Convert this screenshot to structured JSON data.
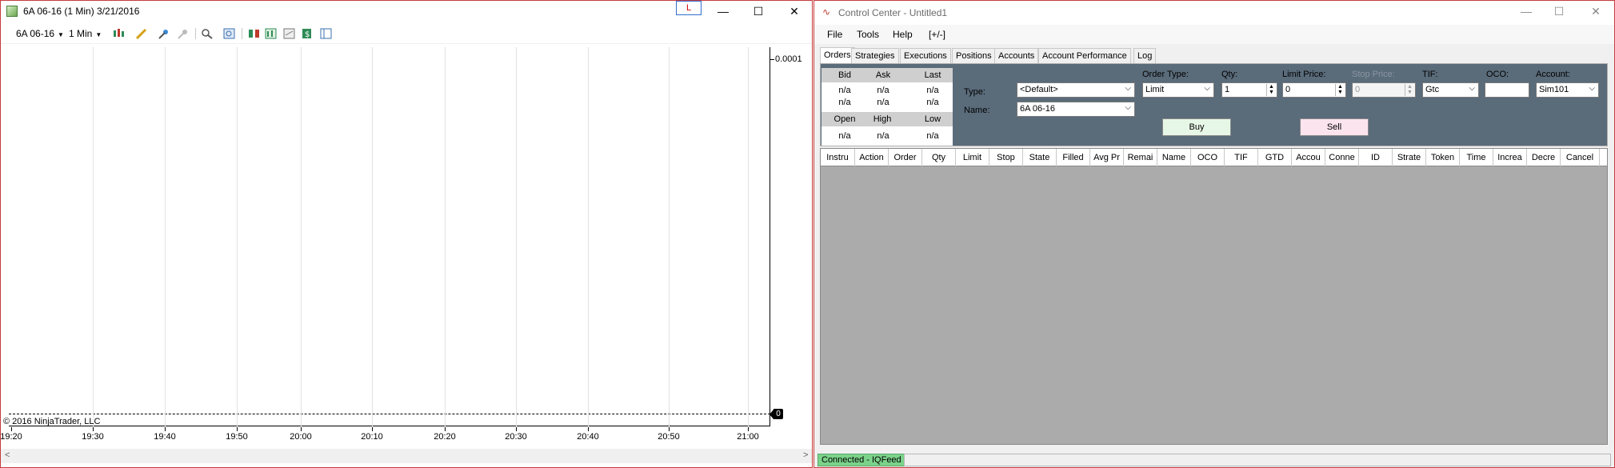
{
  "chart_window": {
    "title": "6A 06-16 (1 Min)  3/21/2016",
    "link_button": "L",
    "controls": {
      "minimize": "—",
      "maximize": "☐",
      "close": "✕"
    },
    "toolbar": {
      "instrument": "6A 06-16",
      "interval": "1 Min"
    },
    "icons": [
      "chart-style-icon",
      "drawing-tool-icon",
      "pin-icon",
      "pin-disabled-icon",
      "zoom-icon",
      "search-icon",
      "strategies-icon",
      "indicators-icon",
      "data-box-icon",
      "dollar-icon",
      "properties-icon"
    ],
    "y_label_top": "0.0001",
    "zero_marker": "0",
    "copyright": "© 2016 NinjaTrader, LLC",
    "scroll_left": "<",
    "scroll_right": ">"
  },
  "chart_data": {
    "type": "line",
    "x_ticks": [
      "19:20",
      "19:30",
      "19:40",
      "19:50",
      "20:00",
      "20:10",
      "20:20",
      "20:30",
      "20:40",
      "20:50",
      "21:00"
    ],
    "y_ticks": [
      "0.0001"
    ],
    "zero_value_label": "0",
    "series": [],
    "grid": "vertical"
  },
  "control_center": {
    "title": "Control Center - Untitled1",
    "controls": {
      "minimize": "—",
      "maximize": "☐",
      "close": "✕"
    },
    "menu": [
      "File",
      "Tools",
      "Help",
      "[+/-]"
    ],
    "tabs": [
      "Orders",
      "Strategies",
      "Executions",
      "Positions",
      "Accounts",
      "Account Performance",
      "Log"
    ],
    "active_tab": "Orders",
    "quote": {
      "bid_label": "Bid",
      "ask_label": "Ask",
      "last_label": "Last",
      "row1": [
        "n/a",
        "n/a",
        "n/a"
      ],
      "row2": [
        "n/a",
        "n/a",
        "n/a"
      ],
      "open_label": "Open",
      "high_label": "High",
      "low_label": "Low",
      "row3": [
        "n/a",
        "n/a",
        "n/a"
      ]
    },
    "order_entry": {
      "type_label": "Type:",
      "type_value": "<Default>",
      "name_label": "Name:",
      "name_value": "6A 06-16",
      "order_type_label": "Order Type:",
      "order_type_value": "Limit",
      "qty_label": "Qty:",
      "qty_value": "1",
      "limit_price_label": "Limit Price:",
      "limit_price_value": "0",
      "stop_price_label": "Stop Price:",
      "stop_price_value": "0",
      "tif_label": "TIF:",
      "tif_value": "Gtc",
      "oco_label": "OCO:",
      "oco_value": "",
      "account_label": "Account:",
      "account_value": "Sim101",
      "buy_label": "Buy",
      "sell_label": "Sell"
    },
    "orders_columns": [
      "Instru",
      "Action",
      "Order",
      "Qty",
      "Limit",
      "Stop",
      "State",
      "Filled",
      "Avg Pr",
      "Remai",
      "Name",
      "OCO",
      "TIF",
      "GTD",
      "Accou",
      "Conne",
      "ID",
      "Strate",
      "Token",
      "Time",
      "Increa",
      "Decre",
      "Cancel"
    ],
    "status": "Connected - IQFeed"
  },
  "colors": {
    "window_border": "#c63b3b",
    "panel_bg": "#5a6b7a",
    "grid_bg": "#ababab",
    "buy_bg": "#e7f7e7",
    "sell_bg": "#fbe4ee",
    "status_connected": "#7bd38a"
  }
}
